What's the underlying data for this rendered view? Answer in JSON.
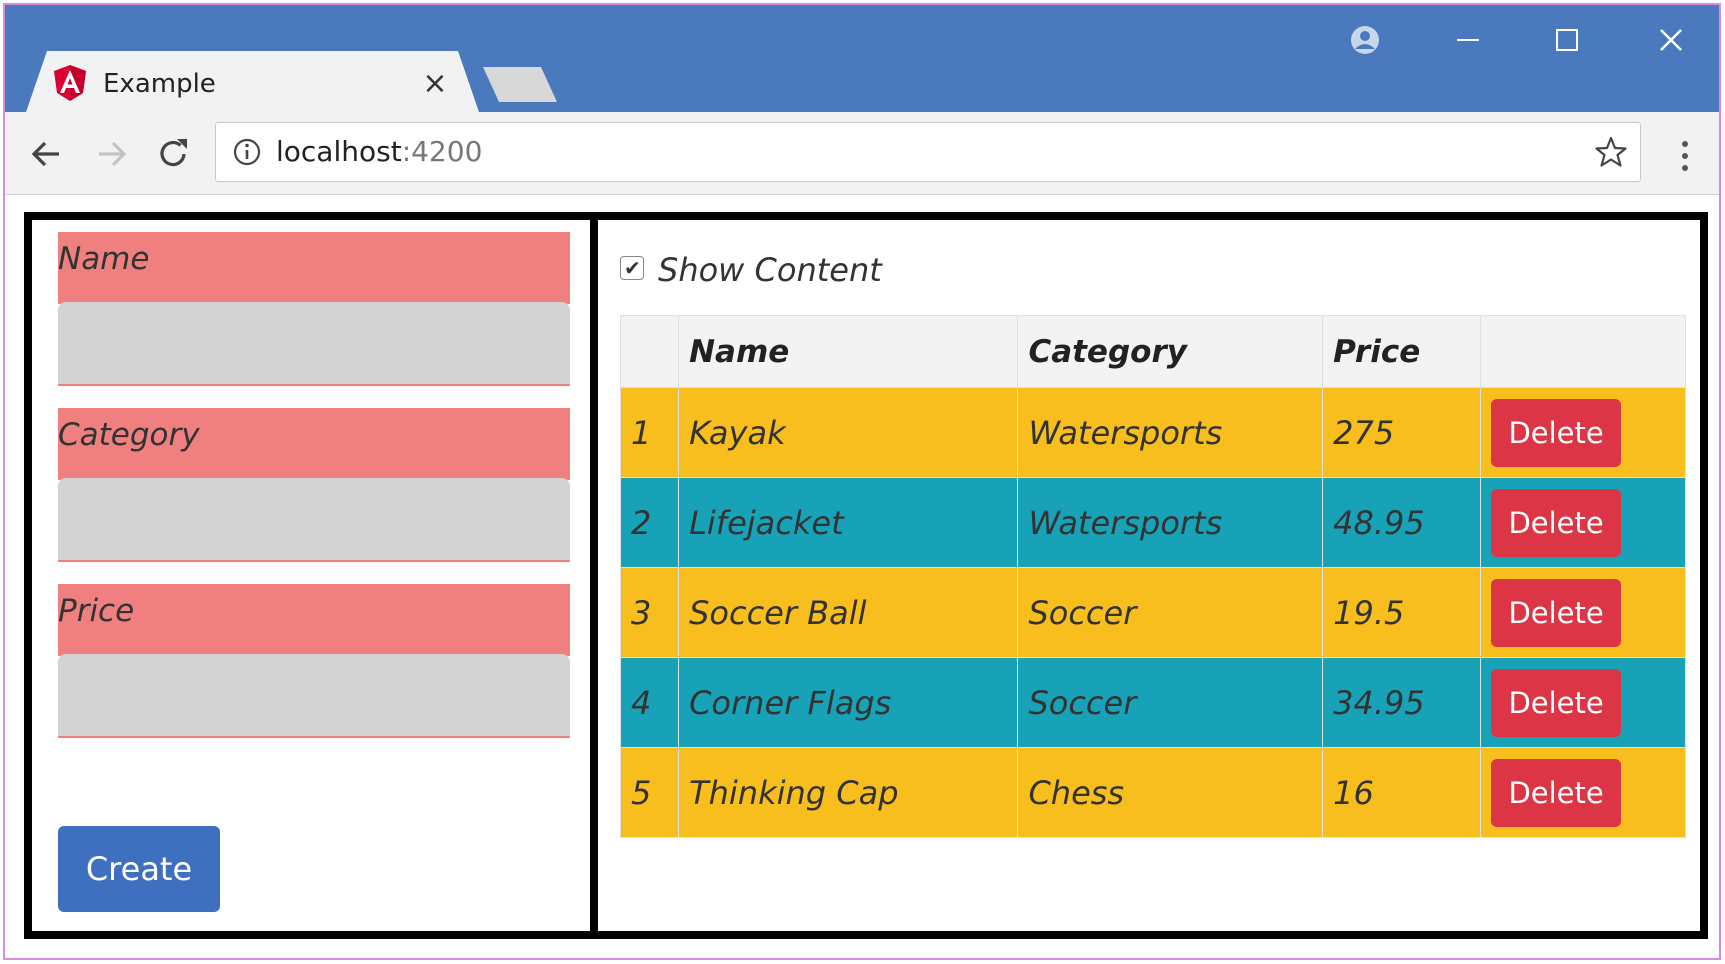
{
  "browser": {
    "tab": {
      "title": "Example",
      "close_glyph": "×"
    },
    "address": {
      "host": "localhost",
      "port": ":4200"
    },
    "colors": {
      "chrome": "#4a7abd",
      "tab": "#f2f2f2"
    }
  },
  "form": {
    "fields": [
      {
        "label": "Name",
        "value": ""
      },
      {
        "label": "Category",
        "value": ""
      },
      {
        "label": "Price",
        "value": ""
      }
    ],
    "create_label": "Create"
  },
  "table_panel": {
    "show_content_label": "Show Content",
    "show_content_checked": true,
    "headers": {
      "index": "",
      "name": "Name",
      "category": "Category",
      "price": "Price",
      "action": ""
    },
    "rows": [
      {
        "index": "1",
        "name": "Kayak",
        "category": "Watersports",
        "price": "275",
        "action": "Delete"
      },
      {
        "index": "2",
        "name": "Lifejacket",
        "category": "Watersports",
        "price": "48.95",
        "action": "Delete"
      },
      {
        "index": "3",
        "name": "Soccer Ball",
        "category": "Soccer",
        "price": "19.5",
        "action": "Delete"
      },
      {
        "index": "4",
        "name": "Corner Flags",
        "category": "Soccer",
        "price": "34.95",
        "action": "Delete"
      },
      {
        "index": "5",
        "name": "Thinking Cap",
        "category": "Chess",
        "price": "16",
        "action": "Delete"
      }
    ],
    "colors": {
      "odd_row": "#f7be1e",
      "even_row": "#18a2b8",
      "delete": "#dc3545",
      "label_bg": "#f08080"
    }
  }
}
